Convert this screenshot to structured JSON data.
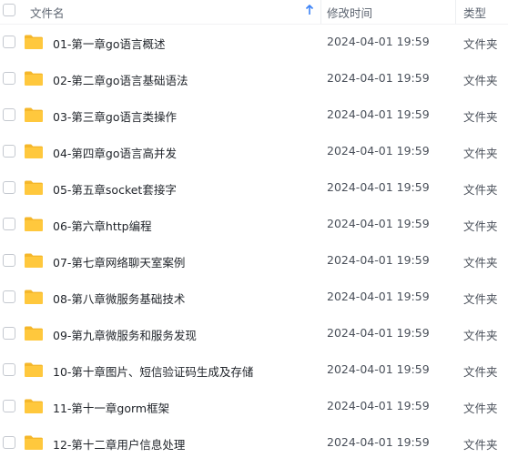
{
  "header": {
    "name_label": "文件名",
    "time_label": "修改时间",
    "type_label": "类型",
    "sort_icon": "arrow-up-icon"
  },
  "colors": {
    "folder": "#ffc83d",
    "folder_tab": "#f5b72a",
    "sort_accent": "#3b82f6"
  },
  "rows": [
    {
      "name": "01-第一章go语言概述",
      "modified": "2024-04-01 19:59",
      "type": "文件夹",
      "icon": "folder-icon"
    },
    {
      "name": "02-第二章go语言基础语法",
      "modified": "2024-04-01 19:59",
      "type": "文件夹",
      "icon": "folder-icon"
    },
    {
      "name": "03-第三章go语言类操作",
      "modified": "2024-04-01 19:59",
      "type": "文件夹",
      "icon": "folder-icon"
    },
    {
      "name": "04-第四章go语言高并发",
      "modified": "2024-04-01 19:59",
      "type": "文件夹",
      "icon": "folder-icon"
    },
    {
      "name": "05-第五章socket套接字",
      "modified": "2024-04-01 19:59",
      "type": "文件夹",
      "icon": "folder-icon"
    },
    {
      "name": "06-第六章http编程",
      "modified": "2024-04-01 19:59",
      "type": "文件夹",
      "icon": "folder-icon"
    },
    {
      "name": "07-第七章网络聊天室案例",
      "modified": "2024-04-01 19:59",
      "type": "文件夹",
      "icon": "folder-icon"
    },
    {
      "name": "08-第八章微服务基础技术",
      "modified": "2024-04-01 19:59",
      "type": "文件夹",
      "icon": "folder-icon"
    },
    {
      "name": "09-第九章微服务和服务发现",
      "modified": "2024-04-01 19:59",
      "type": "文件夹",
      "icon": "folder-icon"
    },
    {
      "name": "10-第十章图片、短信验证码生成及存储",
      "modified": "2024-04-01 19:59",
      "type": "文件夹",
      "icon": "folder-icon"
    },
    {
      "name": "11-第十一章gorm框架",
      "modified": "2024-04-01 19:59",
      "type": "文件夹",
      "icon": "folder-icon"
    },
    {
      "name": "12-第十二章用户信息处理",
      "modified": "2024-04-01 19:59",
      "type": "文件夹",
      "icon": "folder-icon"
    }
  ]
}
